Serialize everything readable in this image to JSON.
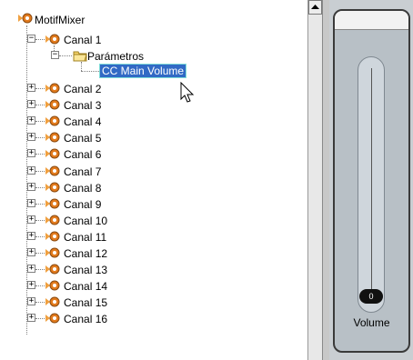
{
  "tree": {
    "root_label": "MotifMixer",
    "expanded_channel": "Canal 1",
    "folder_label": "Parámetros",
    "selected_item": "CC Main Volume",
    "channels": [
      "Canal 2",
      "Canal 3",
      "Canal 4",
      "Canal 5",
      "Canal 6",
      "Canal 7",
      "Canal 8",
      "Canal 9",
      "Canal 10",
      "Canal 11",
      "Canal 12",
      "Canal 13",
      "Canal 14",
      "Canal 15",
      "Canal 16"
    ]
  },
  "fader": {
    "value": "0",
    "label": "Volume",
    "level_fraction": 0
  },
  "colors": {
    "selection_bg": "#316ac5",
    "selection_outline": "#7fdcd8",
    "midi_icon_orange": "#e27a1c"
  },
  "icons": {
    "root": "midi-device-icon",
    "channel": "midi-port-icon",
    "folder": "folder-open-icon"
  }
}
